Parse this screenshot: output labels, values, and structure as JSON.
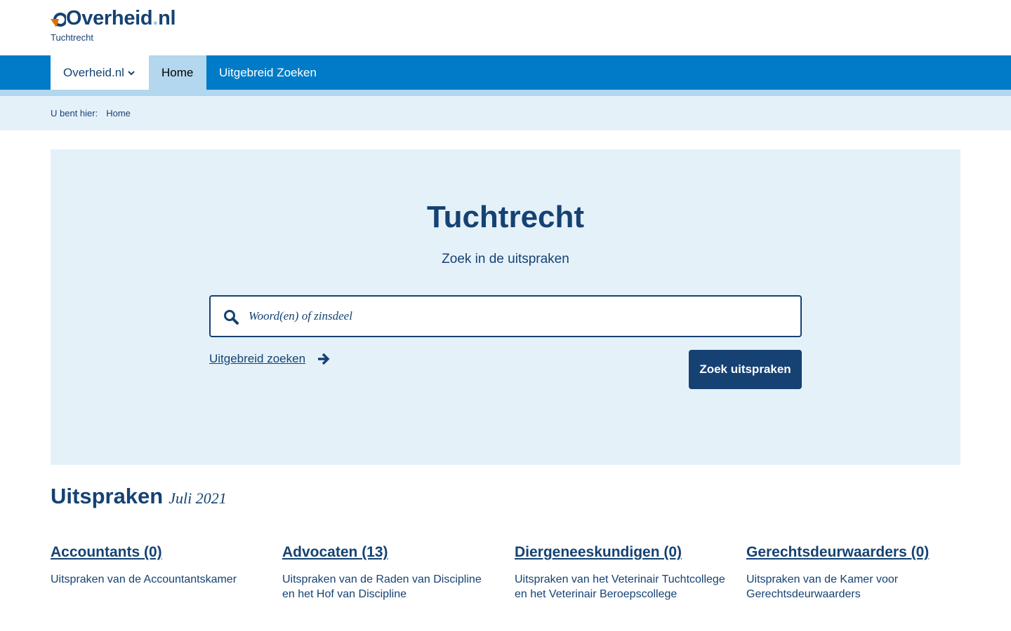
{
  "header": {
    "logo_main": "Overheid",
    "logo_dot": ".",
    "logo_tld": "nl",
    "logo_sub": "Tuchtrecht"
  },
  "nav": {
    "overheid": "Overheid.nl",
    "home": "Home",
    "uitgebreid": "Uitgebreid Zoeken"
  },
  "breadcrumb": {
    "label": "U bent hier:",
    "home": "Home"
  },
  "hero": {
    "title": "Tuchtrecht",
    "subtitle": "Zoek in de uitspraken",
    "search_placeholder": "Woord(en) of zinsdeel",
    "advanced_link": "Uitgebreid zoeken",
    "search_button": "Zoek uitspraken"
  },
  "uitspraken": {
    "title": "Uitspraken",
    "period": "Juli 2021",
    "categories": [
      {
        "label": "Accountants (0)",
        "desc": "Uitspraken van de Accountantskamer"
      },
      {
        "label": "Advocaten (13)",
        "desc": "Uitspraken van de Raden van Discipline en het Hof van Discipline"
      },
      {
        "label": "Diergeneeskundigen (0)",
        "desc": "Uitspraken van het Veterinair Tuchtcollege en het Veterinair Beroepscollege"
      },
      {
        "label": "Gerechtsdeurwaarders (0)",
        "desc": "Uitspraken van de Kamer voor Gerechtsdeurwaarders"
      }
    ]
  },
  "colors": {
    "brand_dark": "#154273",
    "nav_blue": "#007bc7",
    "light_blue": "#b2d7ee",
    "pale_blue": "#e5f1f9",
    "accent_orange": "#e17000"
  },
  "icons": {
    "logo": "overheid-logo-icon",
    "nav_dropdown": "chevron-down-icon",
    "search": "search-icon",
    "advanced": "arrow-right-icon"
  }
}
